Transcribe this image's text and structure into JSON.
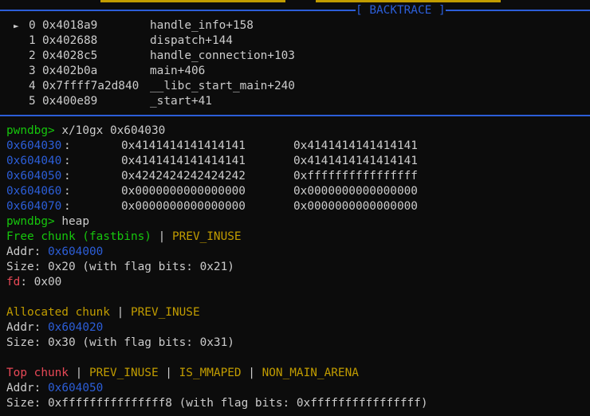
{
  "backtrace": {
    "title": "[ BACKTRACE ]",
    "frames": [
      {
        "index": "0",
        "addr": "0x4018a9",
        "symbol": "handle_info+158"
      },
      {
        "index": "1",
        "addr": "0x402688",
        "symbol": "dispatch+144"
      },
      {
        "index": "2",
        "addr": "0x4028c5",
        "symbol": "handle_connection+103"
      },
      {
        "index": "3",
        "addr": "0x402b0a",
        "symbol": "main+406"
      },
      {
        "index": "4",
        "addr": "0x7ffff7a2d840",
        "symbol": "__libc_start_main+240"
      },
      {
        "index": "5",
        "addr": "0x400e89",
        "symbol": "_start+41"
      }
    ]
  },
  "prompt": "pwndbg>",
  "cmd_examine": "x/10gx 0x604030",
  "memory_rows": [
    {
      "addr": "0x604030",
      "v1": "0x4141414141414141",
      "v2": "0x4141414141414141"
    },
    {
      "addr": "0x604040",
      "v1": "0x4141414141414141",
      "v2": "0x4141414141414141"
    },
    {
      "addr": "0x604050",
      "v1": "0x4242424242424242",
      "v2": "0xffffffffffffffff"
    },
    {
      "addr": "0x604060",
      "v1": "0x0000000000000000",
      "v2": "0x0000000000000000"
    },
    {
      "addr": "0x604070",
      "v1": "0x0000000000000000",
      "v2": "0x0000000000000000"
    }
  ],
  "cmd_heap": "heap",
  "chunks": {
    "free": {
      "title": "Free chunk (fastbins)",
      "flags": [
        "PREV_INUSE"
      ],
      "addr_label": "Addr:",
      "addr": "0x604000",
      "size": "Size: 0x20 (with flag bits: 0x21)",
      "fd_label": "fd",
      "fd_value": ": 0x00"
    },
    "allocated": {
      "title": "Allocated chunk",
      "flags": [
        "PREV_INUSE"
      ],
      "addr_label": "Addr:",
      "addr": "0x604020",
      "size": "Size: 0x30 (with flag bits: 0x31)"
    },
    "top": {
      "title": "Top chunk",
      "flags": [
        "PREV_INUSE",
        "IS_MMAPED",
        "NON_MAIN_ARENA"
      ],
      "addr_label": "Addr:",
      "addr": "0x604050",
      "size": "Size: 0xfffffffffffffff8 (with flag bits: 0xffffffffffffffff)"
    }
  },
  "separator": " | ",
  "colon": ":",
  "colors": {
    "blue": "#2c5ed8",
    "green": "#16c60c",
    "yellow": "#c19c00",
    "red": "#e74856",
    "text": "#cccccc",
    "background": "#0c0c0c"
  },
  "icons": {
    "current_frame": "triangle-right-icon"
  }
}
